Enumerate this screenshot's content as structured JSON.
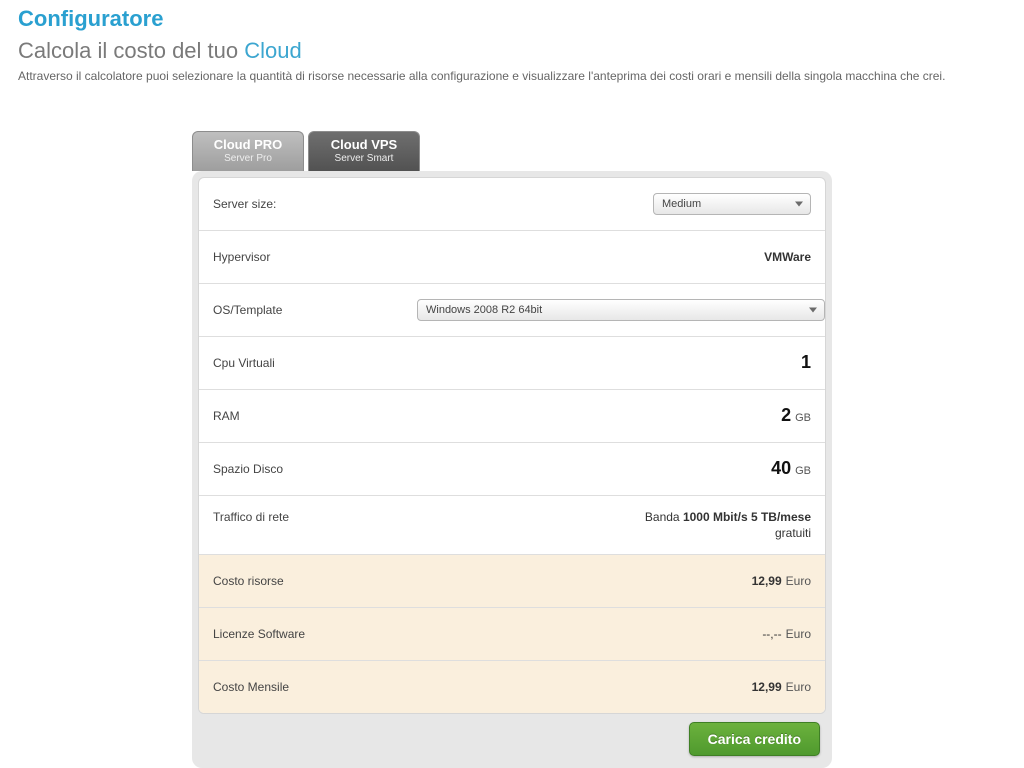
{
  "header": {
    "title": "Configuratore",
    "subtitle_prefix": "Calcola il costo del tuo ",
    "subtitle_accent": "Cloud",
    "description": "Attraverso il calcolatore puoi selezionare la quantità di risorse necessarie alla configurazione e visualizzare l'anteprima dei costi orari e mensili della singola macchina che crei."
  },
  "tabs": {
    "pro": {
      "title": "Cloud PRO",
      "subtitle": "Server Pro"
    },
    "vps": {
      "title": "Cloud VPS",
      "subtitle": "Server Smart"
    }
  },
  "rows": {
    "server_size": {
      "label": "Server size:",
      "selected": "Medium"
    },
    "hypervisor": {
      "label": "Hypervisor",
      "value": "VMWare"
    },
    "os_template": {
      "label": "OS/Template",
      "selected": "Windows 2008 R2 64bit"
    },
    "cpu": {
      "label": "Cpu Virtuali",
      "value": "1"
    },
    "ram": {
      "label": "RAM",
      "value": "2",
      "unit": "GB"
    },
    "disk": {
      "label": "Spazio Disco",
      "value": "40",
      "unit": "GB"
    },
    "traffic": {
      "label": "Traffico di rete",
      "line1_prefix": "Banda ",
      "line1_bold": "1000 Mbit/s 5 TB/mese",
      "line2": "gratuiti"
    },
    "cost_res": {
      "label": "Costo risorse",
      "value": "12,99",
      "currency": "Euro"
    },
    "licenses": {
      "label": "Licenze Software",
      "value": "--,--",
      "currency": "Euro"
    },
    "cost_month": {
      "label": "Costo Mensile",
      "value": "12,99",
      "currency": "Euro"
    }
  },
  "footer": {
    "load_credit": "Carica credito"
  }
}
